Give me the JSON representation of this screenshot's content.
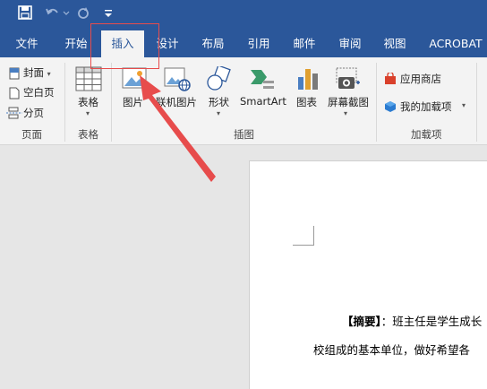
{
  "quick_access": {
    "save_icon": "save-icon",
    "undo_icon": "undo-icon",
    "redo_icon": "redo-icon",
    "customize_icon": "customize-quick-access-icon"
  },
  "tabs": [
    "文件",
    "开始",
    "插入",
    "设计",
    "布局",
    "引用",
    "邮件",
    "审阅",
    "视图",
    "ACROBAT"
  ],
  "active_tab": "插入",
  "ribbon": {
    "pages": {
      "cover": "封面",
      "blank": "空白页",
      "break": "分页",
      "group": "页面"
    },
    "tables": {
      "table": "表格",
      "group": "表格"
    },
    "illustrations": {
      "pictures": "图片",
      "online_pictures": "联机图片",
      "shapes": "形状",
      "smartart": "SmartArt",
      "chart": "图表",
      "screenshot": "屏幕截图",
      "group": "插图"
    },
    "addins": {
      "store": "应用商店",
      "my_addins": "我的加载项",
      "group": "加载项"
    }
  },
  "document": {
    "line1_label": "【摘要】",
    "line1_text": "：班主任是学生成长",
    "line2_text": "校组成的基本单位，做好希望各"
  },
  "colors": {
    "title_bar": "#2b579a",
    "ribbon": "#f3f3f3",
    "annotation": "#e74c4c"
  }
}
